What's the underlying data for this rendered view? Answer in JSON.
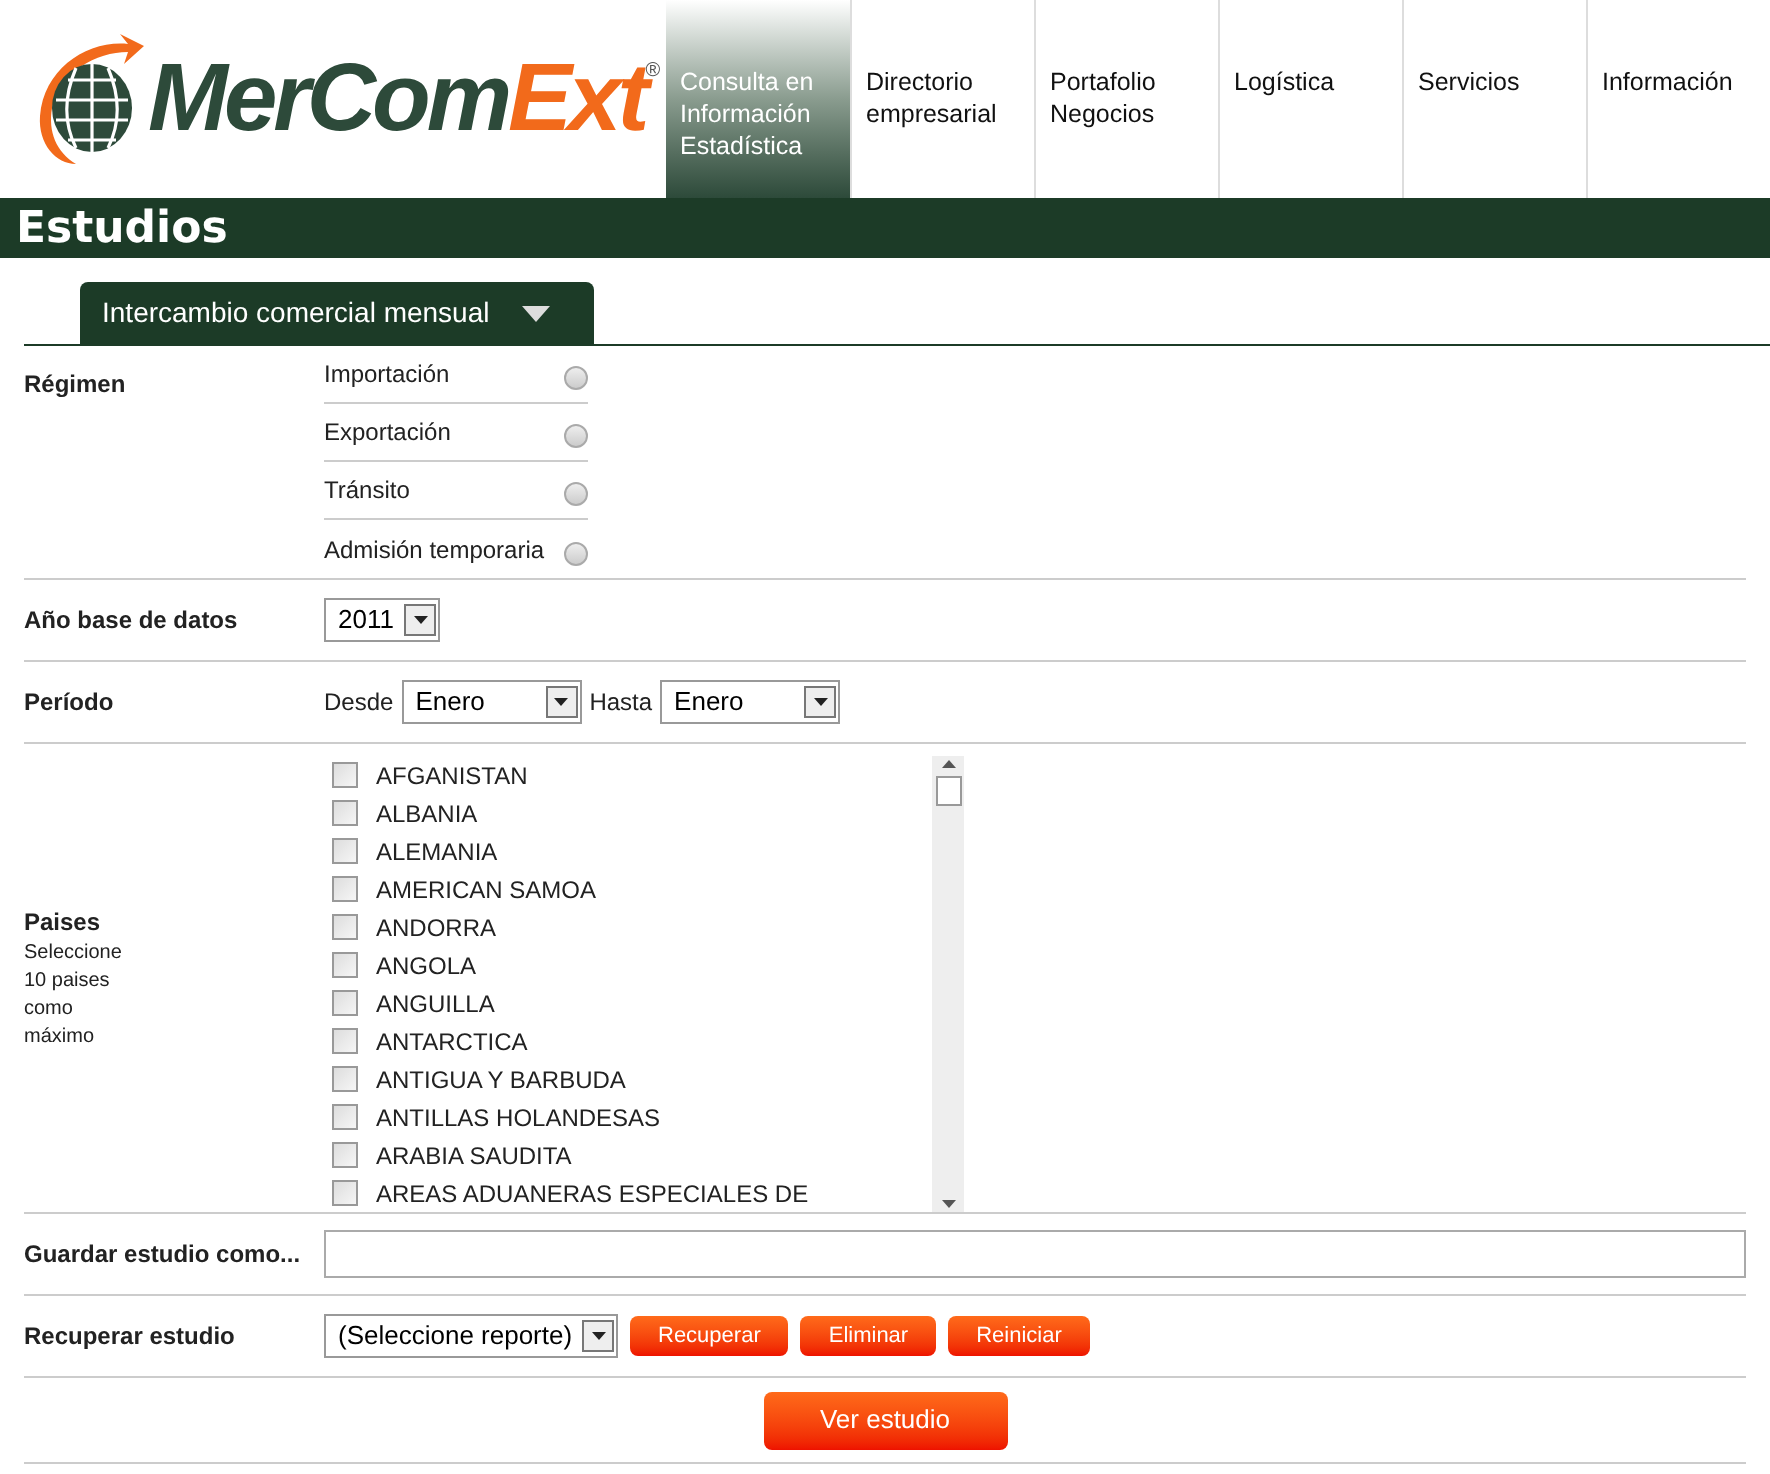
{
  "logo": {
    "part_1": "MerCom",
    "part_2": "Ext",
    "mark": "®"
  },
  "nav": [
    {
      "label": "Consulta en Información Estadística",
      "selected": true
    },
    {
      "label": "Directorio empresarial",
      "selected": false
    },
    {
      "label": "Portafolio Negocios",
      "selected": false
    },
    {
      "label": "Logística",
      "selected": false
    },
    {
      "label": "Servicios",
      "selected": false
    },
    {
      "label": "Información",
      "selected": false
    }
  ],
  "page_title": "Estudios",
  "study_tab": {
    "label": "Intercambio comercial mensual"
  },
  "regimen": {
    "label": "Régimen",
    "options": [
      {
        "label": "Importación",
        "selected": false
      },
      {
        "label": "Exportación",
        "selected": false
      },
      {
        "label": "Tránsito",
        "selected": false
      },
      {
        "label": "Admisión temporaria",
        "selected": false
      }
    ]
  },
  "year": {
    "label": "Año base de datos",
    "value": "2011"
  },
  "period": {
    "label": "Período",
    "from_label": "Desde",
    "from_value": "Enero",
    "to_label": "Hasta",
    "to_value": "Enero"
  },
  "countries": {
    "label": "Paises",
    "hint": "Seleccione 10 paises como máximo",
    "items": [
      {
        "name": "AFGANISTAN",
        "checked": false
      },
      {
        "name": "ALBANIA",
        "checked": false
      },
      {
        "name": "ALEMANIA",
        "checked": false
      },
      {
        "name": "AMERICAN SAMOA",
        "checked": false
      },
      {
        "name": "ANDORRA",
        "checked": false
      },
      {
        "name": "ANGOLA",
        "checked": false
      },
      {
        "name": "ANGUILLA",
        "checked": false
      },
      {
        "name": "ANTARCTICA",
        "checked": false
      },
      {
        "name": "ANTIGUA Y BARBUDA",
        "checked": false
      },
      {
        "name": "ANTILLAS HOLANDESAS",
        "checked": false
      },
      {
        "name": "ARABIA SAUDITA",
        "checked": false
      },
      {
        "name": "AREAS ADUANERAS ESPECIALES DE",
        "checked": false
      }
    ]
  },
  "save": {
    "label": "Guardar estudio como..."
  },
  "recover": {
    "label": "Recuperar estudio",
    "value": "(Seleccione reporte)",
    "buttons": [
      "Recuperar",
      "Eliminar",
      "Reiniciar"
    ]
  },
  "submit": "Ver estudio"
}
